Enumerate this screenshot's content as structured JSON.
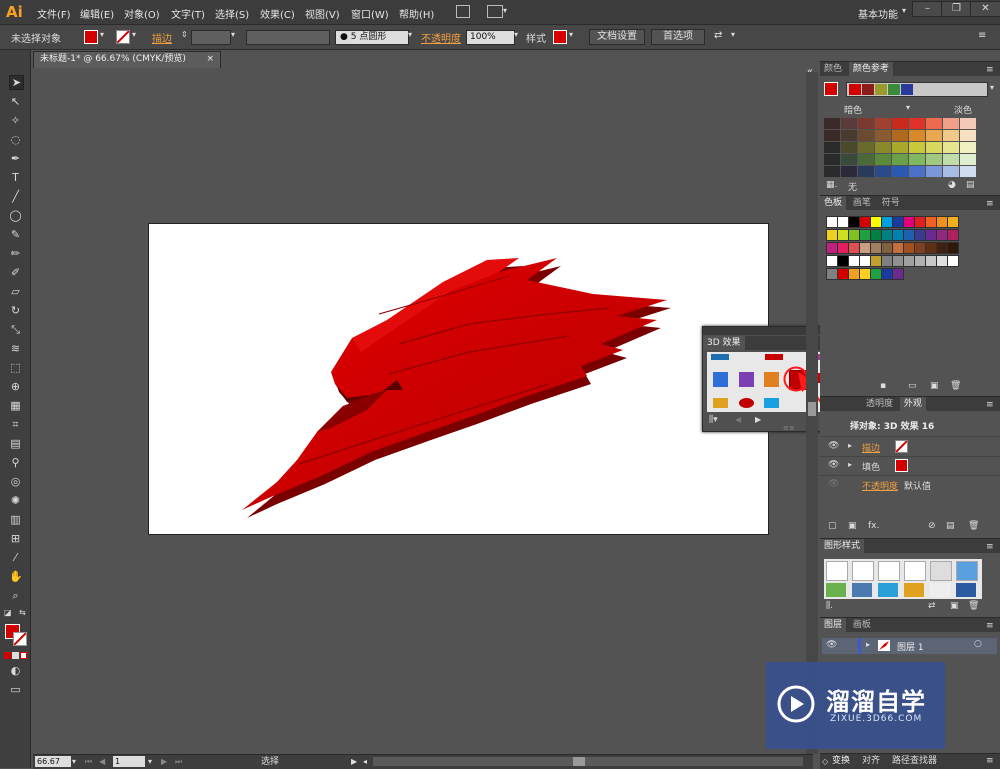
{
  "app": {
    "logo": "Ai",
    "workspace": "基本功能"
  },
  "menus": [
    "文件(F)",
    "编辑(E)",
    "对象(O)",
    "文字(T)",
    "选择(S)",
    "效果(C)",
    "视图(V)",
    "窗口(W)",
    "帮助(H)"
  ],
  "control": {
    "selection": "未选择对象",
    "stroke_label": "描边",
    "brush_size": "5 点圆形",
    "opacity_label": "不透明度",
    "opacity_value": "100%",
    "style_label": "样式",
    "doc_setup": "文档设置",
    "prefs": "首选项"
  },
  "document": {
    "tab_title": "未标题-1* @ 66.67% (CMYK/预览)"
  },
  "colors": {
    "accent_red": "#d40000",
    "shape_red": "#c80000",
    "shape_dark": "#7a0000"
  },
  "color_guide": {
    "tabs": [
      "颜色",
      "颜色参考"
    ],
    "dark_label": "暗色",
    "light_label": "淡色",
    "none_label": "无"
  },
  "swatches": {
    "tabs": [
      "色板",
      "画笔",
      "符号"
    ]
  },
  "panel_3d": {
    "title": "3D 效果"
  },
  "appearance": {
    "tabs": [
      "透明度",
      "外观"
    ],
    "header": "择对象: 3D 效果 16",
    "stroke": "描边",
    "fill": "填色",
    "opacity": "不透明度",
    "opacity_value": "默认值"
  },
  "graphic_styles": {
    "tab": "图形样式"
  },
  "layers": {
    "tabs": [
      "图层",
      "画板"
    ],
    "layer_name": "图层 1"
  },
  "bottom_tabs": [
    "变换",
    "对齐",
    "路径查找器"
  ],
  "status": {
    "zoom": "66.67",
    "page": "1",
    "tool": "选择"
  },
  "watermark": {
    "title": "溜溜自学",
    "url": "ZIXUE.3D66.COM"
  }
}
